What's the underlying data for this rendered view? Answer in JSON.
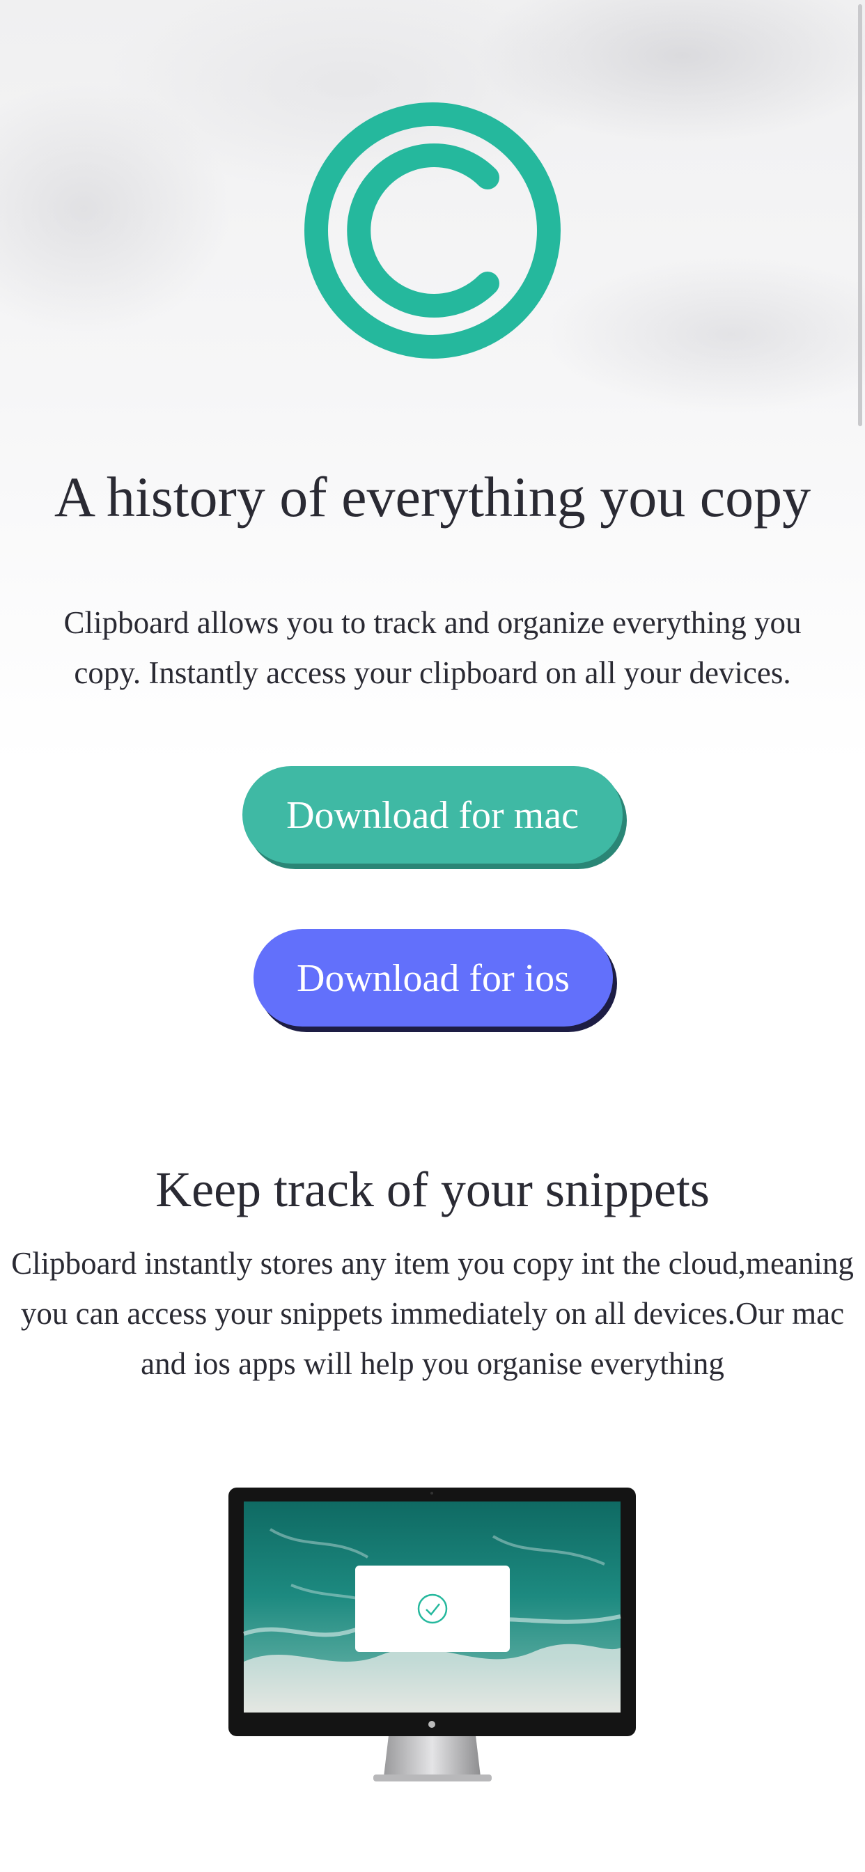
{
  "hero": {
    "logo_icon": "copyright-circle-icon",
    "title": "A history of everything you copy",
    "description": "Clipboard allows you to track and organize everything you copy. Instantly access your clipboard on all your devices."
  },
  "buttons": {
    "mac_label": "Download for mac",
    "ios_label": "Download for ios"
  },
  "snippets": {
    "title": "Keep track of your snippets",
    "description": "Clipboard instantly stores any item you copy int the cloud,meaning you can access your snippets immediately on all devices.Our mac and ios apps will help you organise everything"
  },
  "illustration": {
    "device": "monitor-illustration",
    "dialog_icon": "check-circle-icon"
  },
  "colors": {
    "accent_teal": "#3fb9a4",
    "accent_blue": "#6270fb",
    "text": "#2a2a33"
  }
}
